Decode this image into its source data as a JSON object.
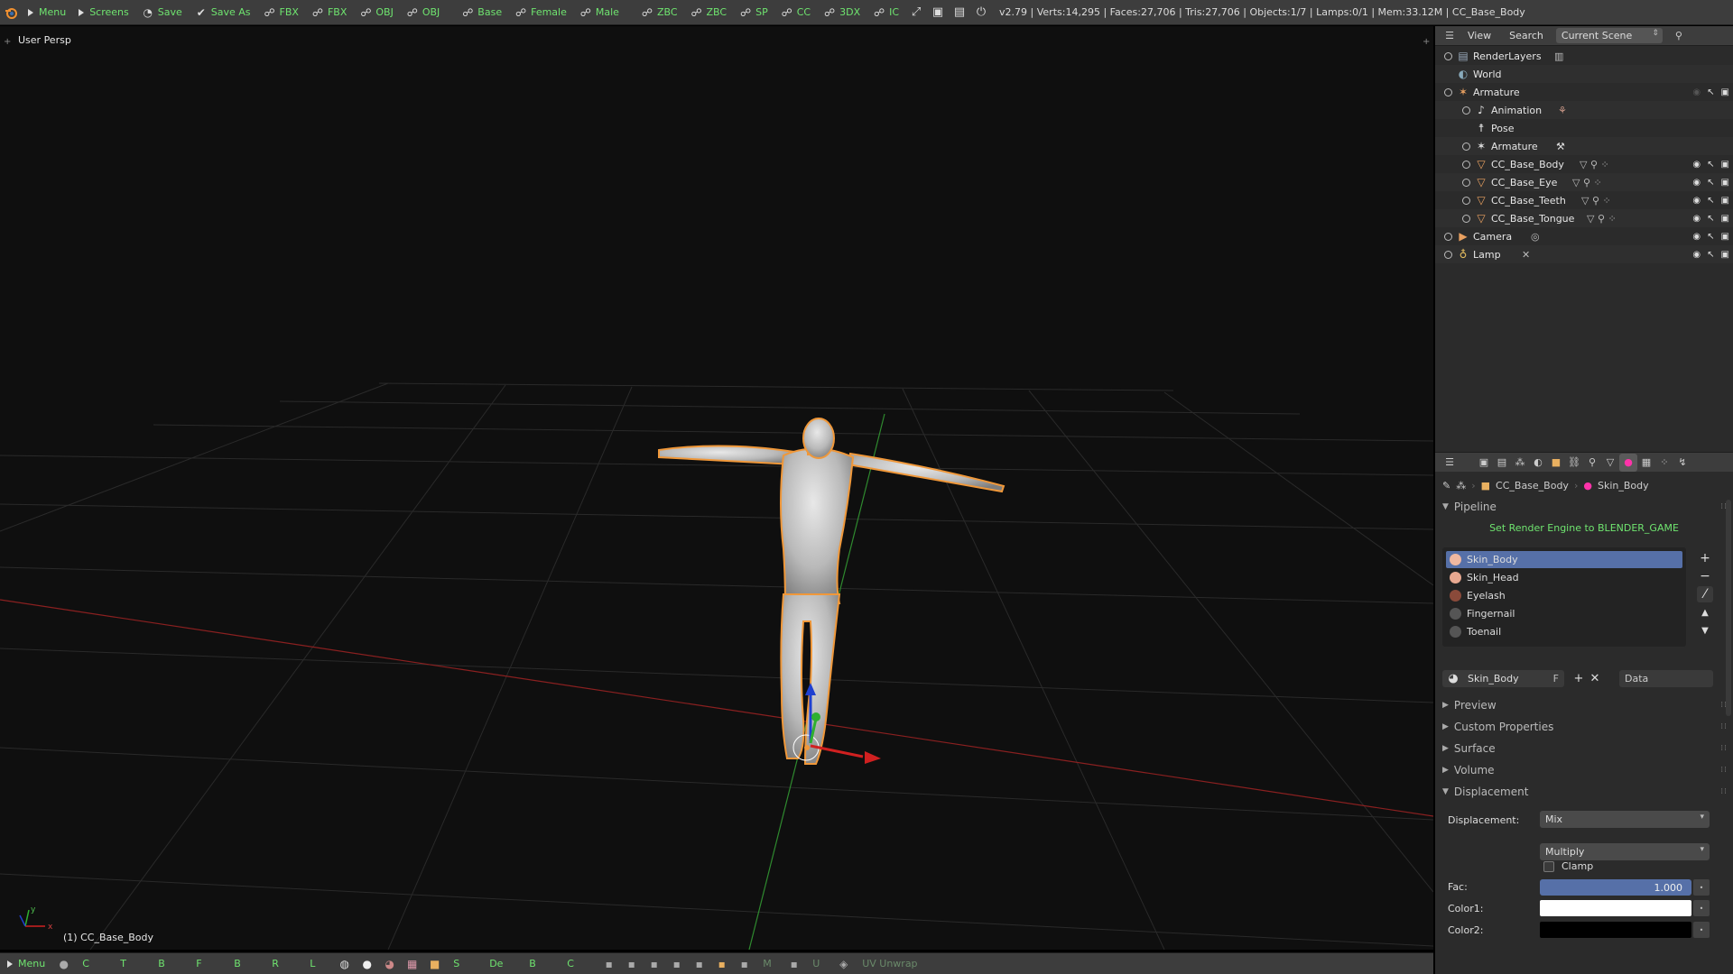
{
  "topbar": {
    "items": [
      {
        "label": "Menu",
        "icon": "play-triangle-icon"
      },
      {
        "label": "Screens",
        "icon": "play-triangle-icon"
      },
      {
        "label": "Save",
        "icon": "save-icon"
      },
      {
        "label": "Save As",
        "icon": "check-icon"
      },
      {
        "label": "FBX",
        "icon": "import-icon"
      },
      {
        "label": "FBX",
        "icon": "export-icon"
      },
      {
        "label": "OBJ",
        "icon": "import-icon"
      },
      {
        "label": "OBJ",
        "icon": "export-icon"
      },
      {
        "label": "Base",
        "icon": "figure-icon"
      },
      {
        "label": "Female",
        "icon": "figure-icon"
      },
      {
        "label": "Male",
        "icon": "figure-icon"
      },
      {
        "label": "ZBC",
        "icon": "bridge-icon"
      },
      {
        "label": "ZBC",
        "icon": "bridge-icon"
      },
      {
        "label": "SP",
        "icon": "bridge-icon"
      },
      {
        "label": "CC",
        "icon": "bridge-icon"
      },
      {
        "label": "3DX",
        "icon": "bridge-icon"
      },
      {
        "label": "IC",
        "icon": "bridge-icon"
      }
    ],
    "stats": "v2.79 | Verts:14,295 | Faces:27,706 | Tris:27,706 | Objects:1/7 | Lamps:0/1 | Mem:33.12M | CC_Base_Body"
  },
  "viewport": {
    "view_name": "User Persp",
    "object_name": "(1) CC_Base_Body",
    "axis_x": "x",
    "axis_y": "y"
  },
  "bottombar": {
    "menu": "Menu",
    "letters": [
      "C",
      "T",
      "B",
      "F",
      "B",
      "R",
      "L"
    ],
    "s_label": "S",
    "de_label": "De",
    "b_label": "B",
    "c_label": "C",
    "m_label": "M",
    "u_label": "U",
    "uv_label": "UV Unwrap"
  },
  "outliner": {
    "view_btn": "View",
    "search_btn": "Search",
    "scene": "Current Scene",
    "rows": [
      {
        "label": "RenderLayers",
        "icon": "render-layers-icon"
      },
      {
        "label": "World",
        "icon": "world-icon"
      },
      {
        "label": "Armature",
        "icon": "armature-icon"
      },
      {
        "label": "Animation",
        "icon": "animation-icon"
      },
      {
        "label": "Pose",
        "icon": "pose-icon"
      },
      {
        "label": "Armature",
        "icon": "armature-data-icon"
      },
      {
        "label": "CC_Base_Body",
        "icon": "mesh-icon"
      },
      {
        "label": "CC_Base_Eye",
        "icon": "mesh-icon"
      },
      {
        "label": "CC_Base_Teeth",
        "icon": "mesh-icon"
      },
      {
        "label": "CC_Base_Tongue",
        "icon": "mesh-icon"
      },
      {
        "label": "Camera",
        "icon": "camera-icon"
      },
      {
        "label": "Lamp",
        "icon": "lamp-icon"
      }
    ]
  },
  "properties": {
    "breadcrumb_object": "CC_Base_Body",
    "breadcrumb_material": "Skin_Body",
    "pipeline_title": "Pipeline",
    "render_warning": "Set Render Engine to BLENDER_GAME",
    "materials": [
      {
        "label": "Skin_Body",
        "color": "#f0b8a0"
      },
      {
        "label": "Skin_Head",
        "color": "#e8a890"
      },
      {
        "label": "Eyelash",
        "color": "#8a4a3a"
      },
      {
        "label": "Fingernail",
        "color": "#cccccc"
      },
      {
        "label": "Toenail",
        "color": "#cccccc"
      }
    ],
    "material_field": "Skin_Body",
    "material_f": "F",
    "data_select": "Data",
    "panels": {
      "preview": "Preview",
      "custom_properties": "Custom Properties",
      "surface": "Surface",
      "volume": "Volume",
      "displacement": "Displacement"
    },
    "displacement_label": "Displacement:",
    "displacement_value": "Mix",
    "blend_value": "Multiply",
    "clamp_label": "Clamp",
    "fac_label": "Fac:",
    "fac_value": "1.000",
    "color1_label": "Color1:",
    "color2_label": "Color2:",
    "color1": "#ffffff",
    "color2": "#000000"
  },
  "colors": {
    "accent_green": "#6fe46f",
    "selection_blue": "#5670a8",
    "header_gray": "#3d3d3d",
    "viewport_bg": "#0f0f0f",
    "outline_orange": "#f0983a"
  }
}
